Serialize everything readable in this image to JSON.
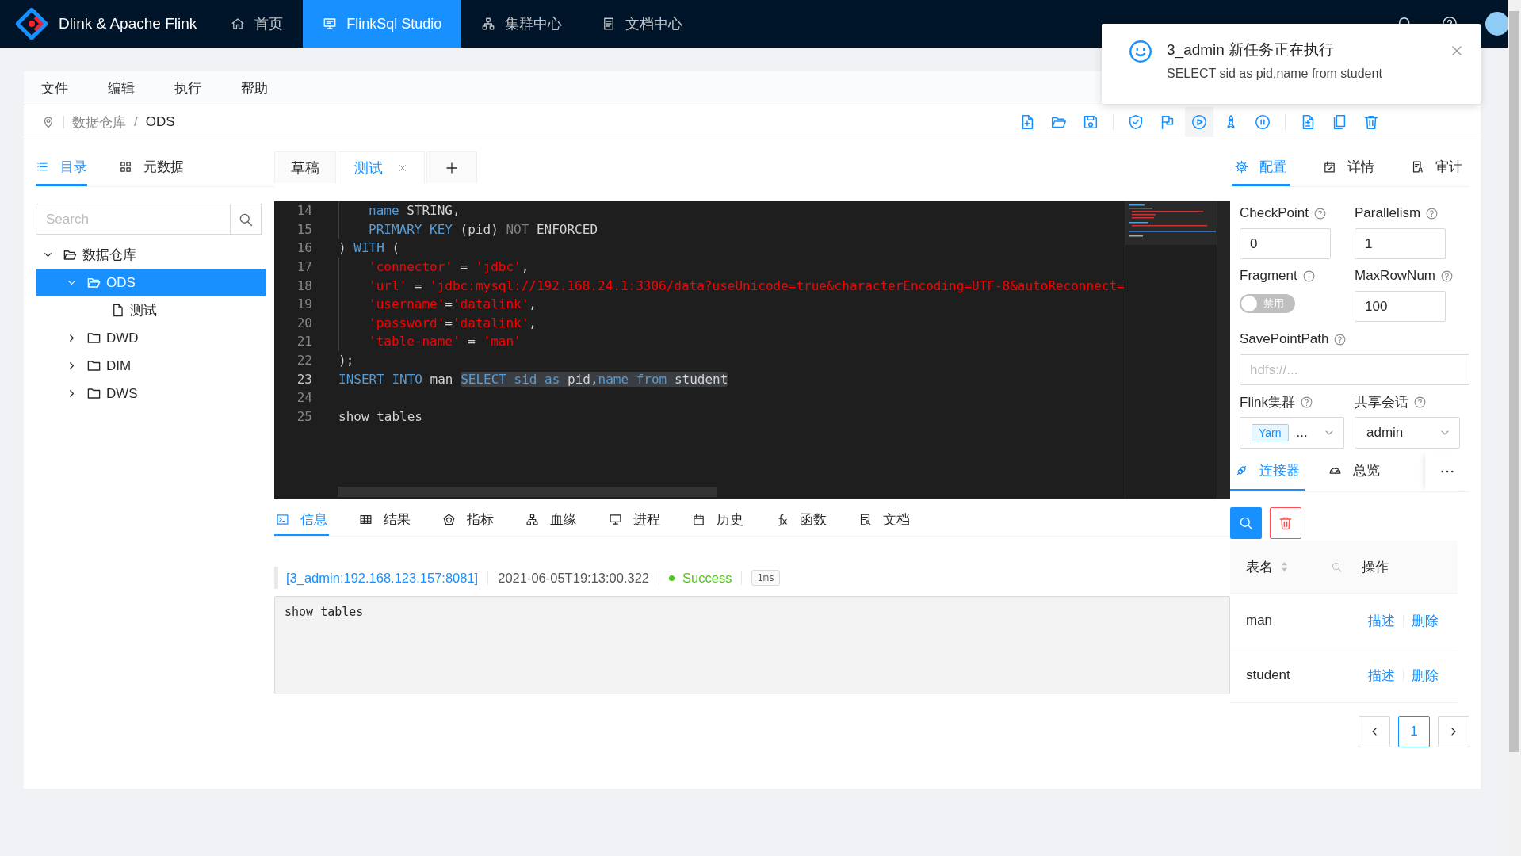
{
  "app": {
    "title": "Dlink & Apache Flink"
  },
  "nav": [
    {
      "label": "首页",
      "selected": false
    },
    {
      "label": "FlinkSql Studio",
      "selected": true
    },
    {
      "label": "集群中心",
      "selected": false
    },
    {
      "label": "文档中心",
      "selected": false
    }
  ],
  "notification": {
    "title": "3_admin 新任务正在执行",
    "message": "SELECT sid as pid,name from student"
  },
  "menu": [
    "文件",
    "编辑",
    "执行",
    "帮助"
  ],
  "breadcrumb": {
    "items": [
      "数据仓库",
      "ODS"
    ],
    "separator": "/"
  },
  "sidebar": {
    "tabs": [
      {
        "label": "目录",
        "selected": true
      },
      {
        "label": "元数据",
        "selected": false
      }
    ],
    "search": {
      "placeholder": "Search"
    },
    "tree": [
      {
        "label": "数据仓库",
        "kind": "folder",
        "expanded": true,
        "selected": false,
        "children": [
          {
            "label": "ODS",
            "kind": "folder",
            "expanded": true,
            "selected": true,
            "children": [
              {
                "label": "测试",
                "kind": "file",
                "selected": false
              }
            ]
          },
          {
            "label": "DWD",
            "kind": "folder",
            "expanded": false,
            "selected": false
          },
          {
            "label": "DIM",
            "kind": "folder",
            "expanded": false,
            "selected": false
          },
          {
            "label": "DWS",
            "kind": "folder",
            "expanded": false,
            "selected": false
          }
        ]
      }
    ]
  },
  "editor": {
    "tabs": [
      {
        "label": "草稿",
        "selected": false,
        "closable": false
      },
      {
        "label": "测试",
        "selected": true,
        "closable": true
      }
    ],
    "lines": [
      {
        "number": "14",
        "current": false,
        "indented": true,
        "tokens": [
          {
            "kind": "kw",
            "t": "name"
          },
          {
            "kind": "plain",
            "t": " STRING,"
          }
        ]
      },
      {
        "number": "15",
        "current": false,
        "indented": true,
        "tokens": [
          {
            "kind": "kw",
            "t": "PRIMARY KEY"
          },
          {
            "kind": "plain",
            "t": " (pid) "
          },
          {
            "kind": "muted",
            "t": "NOT"
          },
          {
            "kind": "plain",
            "t": " ENFORCED"
          }
        ]
      },
      {
        "number": "16",
        "current": false,
        "indented": false,
        "tokens": [
          {
            "kind": "plain",
            "t": ") "
          },
          {
            "kind": "kw",
            "t": "WITH"
          },
          {
            "kind": "plain",
            "t": " ("
          }
        ]
      },
      {
        "number": "17",
        "current": false,
        "indented": true,
        "tokens": [
          {
            "kind": "str",
            "t": "'connector'"
          },
          {
            "kind": "plain",
            "t": " = "
          },
          {
            "kind": "str",
            "t": "'jdbc'"
          },
          {
            "kind": "plain",
            "t": ","
          }
        ]
      },
      {
        "number": "18",
        "current": false,
        "indented": true,
        "tokens": [
          {
            "kind": "str",
            "t": "'url'"
          },
          {
            "kind": "plain",
            "t": " = "
          },
          {
            "kind": "str",
            "t": "'jdbc:mysql://192.168.24.1:3306/data?useUnicode=true&characterEncoding=UTF-8&autoReconnect="
          }
        ]
      },
      {
        "number": "19",
        "current": false,
        "indented": true,
        "tokens": [
          {
            "kind": "str",
            "t": "'username'"
          },
          {
            "kind": "plain",
            "t": "="
          },
          {
            "kind": "str",
            "t": "'datalink'"
          },
          {
            "kind": "plain",
            "t": ","
          }
        ]
      },
      {
        "number": "20",
        "current": false,
        "indented": true,
        "tokens": [
          {
            "kind": "str",
            "t": "'password'"
          },
          {
            "kind": "plain",
            "t": "="
          },
          {
            "kind": "str",
            "t": "'datalink'"
          },
          {
            "kind": "plain",
            "t": ","
          }
        ]
      },
      {
        "number": "21",
        "current": false,
        "indented": true,
        "tokens": [
          {
            "kind": "str",
            "t": "'table-name'"
          },
          {
            "kind": "plain",
            "t": " = "
          },
          {
            "kind": "str",
            "t": "'man'"
          }
        ]
      },
      {
        "number": "22",
        "current": false,
        "indented": false,
        "tokens": [
          {
            "kind": "plain",
            "t": ");"
          }
        ]
      },
      {
        "number": "23",
        "current": true,
        "indented": false,
        "tokens": [
          {
            "kind": "kw",
            "t": "INSERT INTO"
          },
          {
            "kind": "plain",
            "t": " man "
          }
        ],
        "selection": [
          {
            "kind": "kw",
            "t": "SELECT sid as"
          },
          {
            "kind": "plain",
            "t": " pid,"
          },
          {
            "kind": "kw",
            "t": "name from"
          },
          {
            "kind": "plain",
            "t": " student"
          }
        ]
      },
      {
        "number": "24",
        "current": false,
        "indented": false
      },
      {
        "number": "25",
        "current": false,
        "indented": false,
        "tokens": [
          {
            "kind": "plain",
            "t": "show tables"
          }
        ]
      }
    ]
  },
  "output": {
    "tabs": [
      {
        "label": "信息",
        "selected": true
      },
      {
        "label": "结果",
        "selected": false
      },
      {
        "label": "指标",
        "selected": false
      },
      {
        "label": "血缘",
        "selected": false
      },
      {
        "label": "进程",
        "selected": false
      },
      {
        "label": "历史",
        "selected": false
      },
      {
        "label": "函数",
        "selected": false
      },
      {
        "label": "文档",
        "selected": false
      }
    ],
    "log": {
      "source": "[3_admin:192.168.123.157:8081]",
      "time": "2021-06-05T19:13:00.322",
      "status": "Success",
      "duration": "1ms"
    },
    "console": "show tables"
  },
  "config": {
    "tabs": [
      {
        "label": "配置",
        "selected": true
      },
      {
        "label": "详情",
        "selected": false
      },
      {
        "label": "审计",
        "selected": false
      }
    ],
    "checkpoint": {
      "label": "CheckPoint",
      "value": "0"
    },
    "parallelism": {
      "label": "Parallelism",
      "value": "1"
    },
    "fragment": {
      "label": "Fragment",
      "on": false,
      "text": "禁用"
    },
    "max_row_num": {
      "label": "MaxRowNum",
      "value": "100"
    },
    "savepoint_path": {
      "label": "SavePointPath",
      "placeholder": "hdfs://..."
    },
    "flink_cluster": {
      "label": "Flink集群",
      "tag": "Yarn",
      "value": "..."
    },
    "shared_session": {
      "label": "共享会话",
      "value": "admin"
    }
  },
  "connector": {
    "tabs": [
      {
        "label": "连接器",
        "selected": true
      },
      {
        "label": "总览",
        "selected": false
      }
    ],
    "columns": [
      "表名",
      "操作"
    ],
    "rows": [
      {
        "name": "man",
        "actions": [
          "描述",
          "删除"
        ]
      },
      {
        "name": "student",
        "actions": [
          "描述",
          "删除"
        ]
      }
    ],
    "pages": [
      {
        "label": "1",
        "selected": true
      }
    ]
  }
}
